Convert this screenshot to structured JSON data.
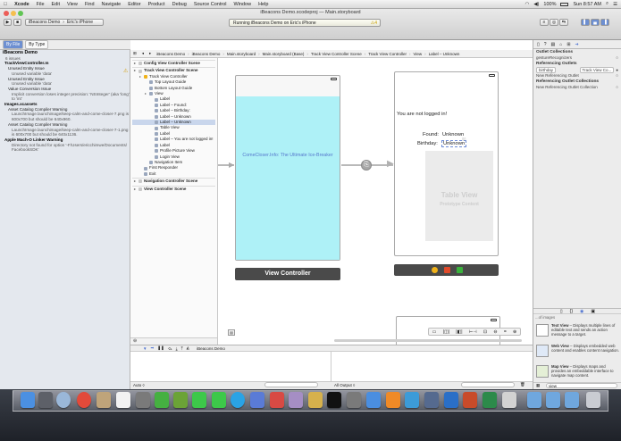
{
  "menubar": {
    "apple": "",
    "items": [
      "Xcode",
      "File",
      "Edit",
      "View",
      "Find",
      "Navigate",
      "Editor",
      "Product",
      "Debug",
      "Source Control",
      "Window",
      "Help"
    ],
    "clock": "Sun 8:57 AM",
    "battery": "100%"
  },
  "window": {
    "title": "iBeacons Demo.xcodeproj — Main.storyboard",
    "title_project": "iBeacons Demo.xcodeproj",
    "title_file": "Main.storyboard"
  },
  "toolbar": {
    "scheme": "iBeacons Demo",
    "device": "Eric's iPhone",
    "activity": "Running iBeacons Demo on Eric's iPhone",
    "warning_count": "4"
  },
  "navigator": {
    "tabs": [
      "By File",
      "By Type"
    ],
    "project": "iBeacons Demo",
    "project_count": "6 issues",
    "issues": [
      {
        "kind": "grp",
        "text": "TrackViewController.m"
      },
      {
        "kind": "warn",
        "text": "Unused Entity Issue"
      },
      {
        "kind": "det",
        "text": "Unused variable 'data'"
      },
      {
        "kind": "warn",
        "text": "Unused Entity Issue"
      },
      {
        "kind": "det",
        "text": "Unused variable 'data'"
      },
      {
        "kind": "warn",
        "text": "Value Conversion Issue"
      },
      {
        "kind": "det",
        "text": "Implicit conversion loses integer precision: 'NSInteger' (aka 'long')"
      },
      {
        "kind": "det",
        "text": "to 'int'"
      },
      {
        "kind": "grp",
        "text": "Images.xcassets"
      },
      {
        "kind": "warn",
        "text": "Asset Catalog Compiler Warning"
      },
      {
        "kind": "det",
        "text": "LaunchImage.launchimage/keep-calm-and-come-closer-7.png is"
      },
      {
        "kind": "det",
        "text": "600x700 but should be 640x960."
      },
      {
        "kind": "warn",
        "text": "Asset Catalog Compiler Warning"
      },
      {
        "kind": "det",
        "text": "LaunchImage.launchimage/keep-calm-and-come-closer-7-1.png"
      },
      {
        "kind": "det",
        "text": "is 600x700 but should be 640x1136."
      },
      {
        "kind": "grp",
        "text": "Apple Mach-O Linker Warning"
      },
      {
        "kind": "det",
        "text": "Directory not found for option '-F/Users/ericchimwe/Documents/"
      },
      {
        "kind": "det",
        "text": "FacebookSDK'"
      }
    ]
  },
  "jumpbar": [
    "iBeacons Demo",
    "iBeacons Demo",
    "Main.storyboard",
    "Main.storyboard (Base)",
    "Track View Controller Scene",
    "Track View Controller",
    "View",
    "Label – Unknown"
  ],
  "outline": {
    "rows": [
      {
        "indent": 0,
        "kind": "scn",
        "text": "Config View Controller Scene"
      },
      {
        "indent": 0,
        "kind": "scn",
        "text": "Track View Controller Scene"
      },
      {
        "indent": 1,
        "kind": "vc",
        "text": "Track View Controller"
      },
      {
        "indent": 2,
        "kind": "item",
        "text": "Top Layout Guide"
      },
      {
        "indent": 2,
        "kind": "item",
        "text": "Bottom Layout Guide"
      },
      {
        "indent": 2,
        "kind": "item",
        "text": "View"
      },
      {
        "indent": 3,
        "kind": "item",
        "text": "Label"
      },
      {
        "indent": 3,
        "kind": "item",
        "text": "Label – Found:"
      },
      {
        "indent": 3,
        "kind": "item",
        "text": "Label – Birthday:"
      },
      {
        "indent": 3,
        "kind": "item",
        "text": "Label – Unknown"
      },
      {
        "indent": 3,
        "kind": "sel",
        "text": "Label – Unknown"
      },
      {
        "indent": 3,
        "kind": "item",
        "text": "Table View"
      },
      {
        "indent": 3,
        "kind": "item",
        "text": "Label"
      },
      {
        "indent": 3,
        "kind": "item",
        "text": "Label – You are not logged in!"
      },
      {
        "indent": 3,
        "kind": "item",
        "text": "Label"
      },
      {
        "indent": 3,
        "kind": "item",
        "text": "Profile Picture View"
      },
      {
        "indent": 3,
        "kind": "item",
        "text": "Login View"
      },
      {
        "indent": 2,
        "kind": "item",
        "text": "Navigation Item"
      },
      {
        "indent": 1,
        "kind": "item",
        "text": "First Responder"
      },
      {
        "indent": 1,
        "kind": "item",
        "text": "Exit"
      },
      {
        "indent": 0,
        "kind": "scn",
        "text": "Navigation Controller Scene"
      },
      {
        "indent": 0,
        "kind": "scn",
        "text": "View Controller Scene"
      }
    ]
  },
  "canvas": {
    "left_scene_label": "ComeCloser.Info: The Ultimate Ice-Breaker",
    "left_scene_title": "View Controller",
    "not_logged_in": "You are not logged in!",
    "found_label": "Found:",
    "found_value": "Unknown",
    "birthday_label": "Birthday:",
    "birthday_value": "Unknown",
    "table_title": "Table View",
    "table_subtitle": "Prototype Content",
    "colors": {
      "cyan_view": "#aef1f7",
      "scene_bar": "#4a4a4a"
    }
  },
  "debug": {
    "target": "iBeacons Demo",
    "auto": "Auto ◊",
    "all_output": "All Output ◊"
  },
  "inspector": {
    "outlet_collections": "Outlet Collections",
    "gesture_recognizers": "gestureRecognizers",
    "referencing_outlets": "Referencing Outlets",
    "birthday_outlet": "birthday",
    "birthday_target": "Track View Co...",
    "new_ref_outlet": "New Referencing Outlet",
    "ref_outlet_collections": "Referencing Outlet Collections",
    "new_ref_collection": "New Referencing Outlet Collection",
    "library": [
      {
        "title": "Text View",
        "desc": "– Displays multiple lines of editable text and sends an action message to a target."
      },
      {
        "title": "Web View",
        "desc": "– Displays embedded web content and enables content navigation."
      },
      {
        "title": "Map View",
        "desc": "– Displays maps and provides an embeddable interface to navigate map content."
      }
    ],
    "library_top": "...of images",
    "filter": "view"
  }
}
